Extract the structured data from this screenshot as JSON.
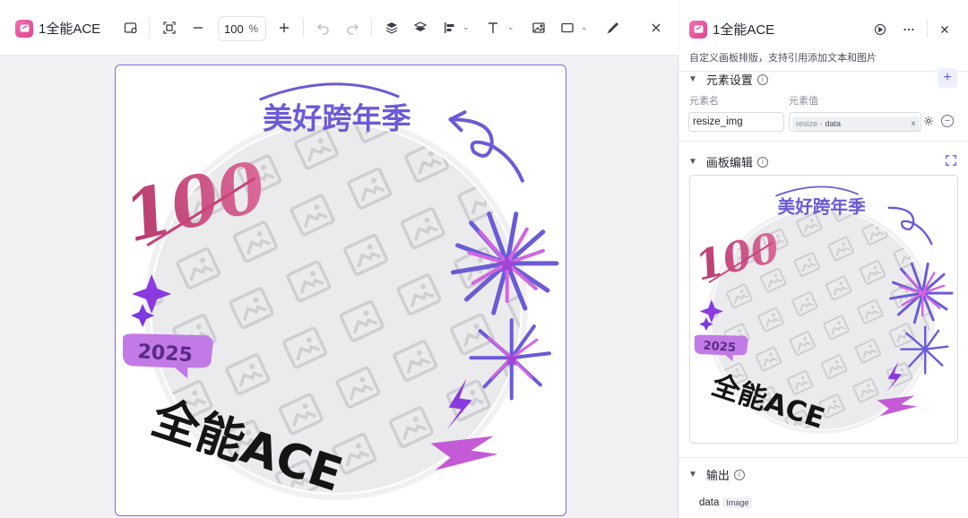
{
  "app": {
    "name": "1全能ACE"
  },
  "toolbar": {
    "zoom_value": "100",
    "zoom_unit": "%"
  },
  "artwork": {
    "headline": "美好跨年季",
    "score": "100",
    "year": "2025",
    "slogan": "全能ACE",
    "accent_color": "#6b5bd6",
    "pink_color": "#c9417a",
    "magenta_color": "#c45ad6"
  },
  "panel": {
    "title": "1全能ACE",
    "description": "自定义画板排版，支持引用添加文本和图片",
    "element_settings": {
      "title": "元素设置",
      "name_label": "元素名",
      "value_label": "元素值",
      "name_value": "resize_img",
      "value_tag_prefix": "resize -",
      "value_tag_name": "data"
    },
    "board_edit": {
      "title": "画板编辑"
    },
    "output": {
      "title": "输出",
      "items": [
        {
          "name": "data",
          "type": "Image"
        }
      ]
    }
  }
}
